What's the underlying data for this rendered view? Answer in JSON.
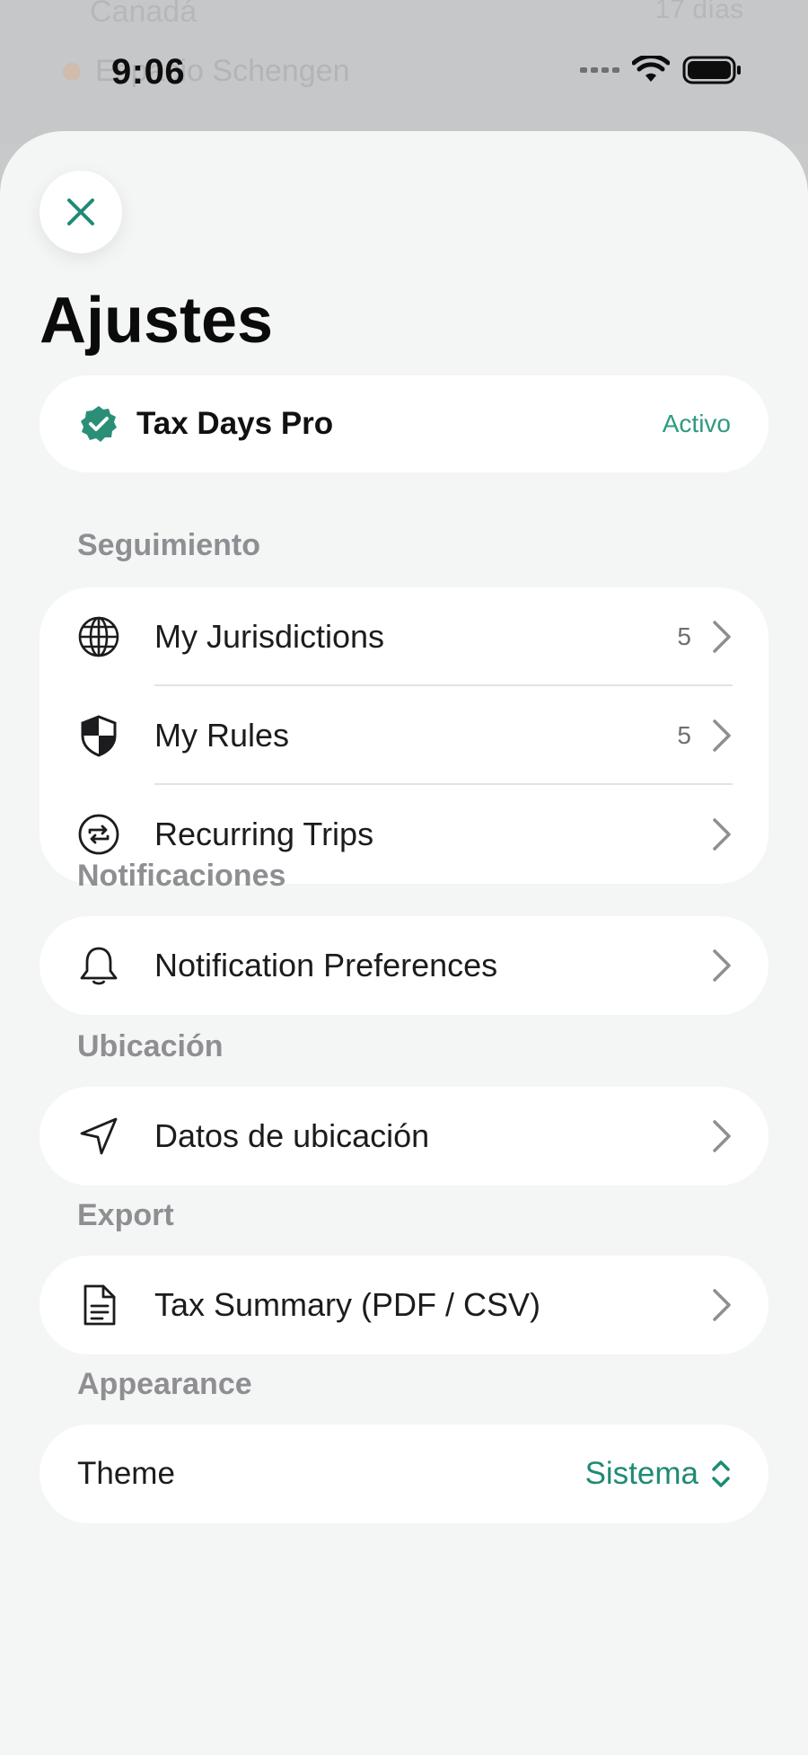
{
  "status_bar": {
    "time": "9:06"
  },
  "background": {
    "ghost_text_top": "Canadá",
    "ghost_text": "Espacio Schengen",
    "ghost_value": "17 días"
  },
  "page": {
    "title": "Ajustes"
  },
  "pro": {
    "label": "Tax Days Pro",
    "status": "Activo"
  },
  "sections": {
    "tracking": {
      "title": "Seguimiento",
      "items": [
        {
          "label": "My Jurisdictions",
          "count": "5",
          "icon": "globe-icon"
        },
        {
          "label": "My Rules",
          "count": "5",
          "icon": "shield-icon"
        },
        {
          "label": "Recurring Trips",
          "count": "",
          "icon": "repeat-icon"
        }
      ]
    },
    "notifications": {
      "title": "Notificaciones",
      "item": {
        "label": "Notification Preferences",
        "icon": "bell-icon"
      }
    },
    "location": {
      "title": "Ubicación",
      "item": {
        "label": "Datos de ubicación",
        "icon": "location-arrow-icon"
      }
    },
    "export": {
      "title": "Export",
      "item": {
        "label": "Tax Summary (PDF / CSV)",
        "icon": "document-icon"
      }
    },
    "appearance": {
      "title": "Appearance",
      "theme_label": "Theme",
      "theme_value": "Sistema"
    }
  },
  "colors": {
    "accent": "#1f8b74",
    "sheet_bg": "#f4f5f5",
    "card_bg": "#ffffff",
    "section_text": "#8e8e93"
  }
}
